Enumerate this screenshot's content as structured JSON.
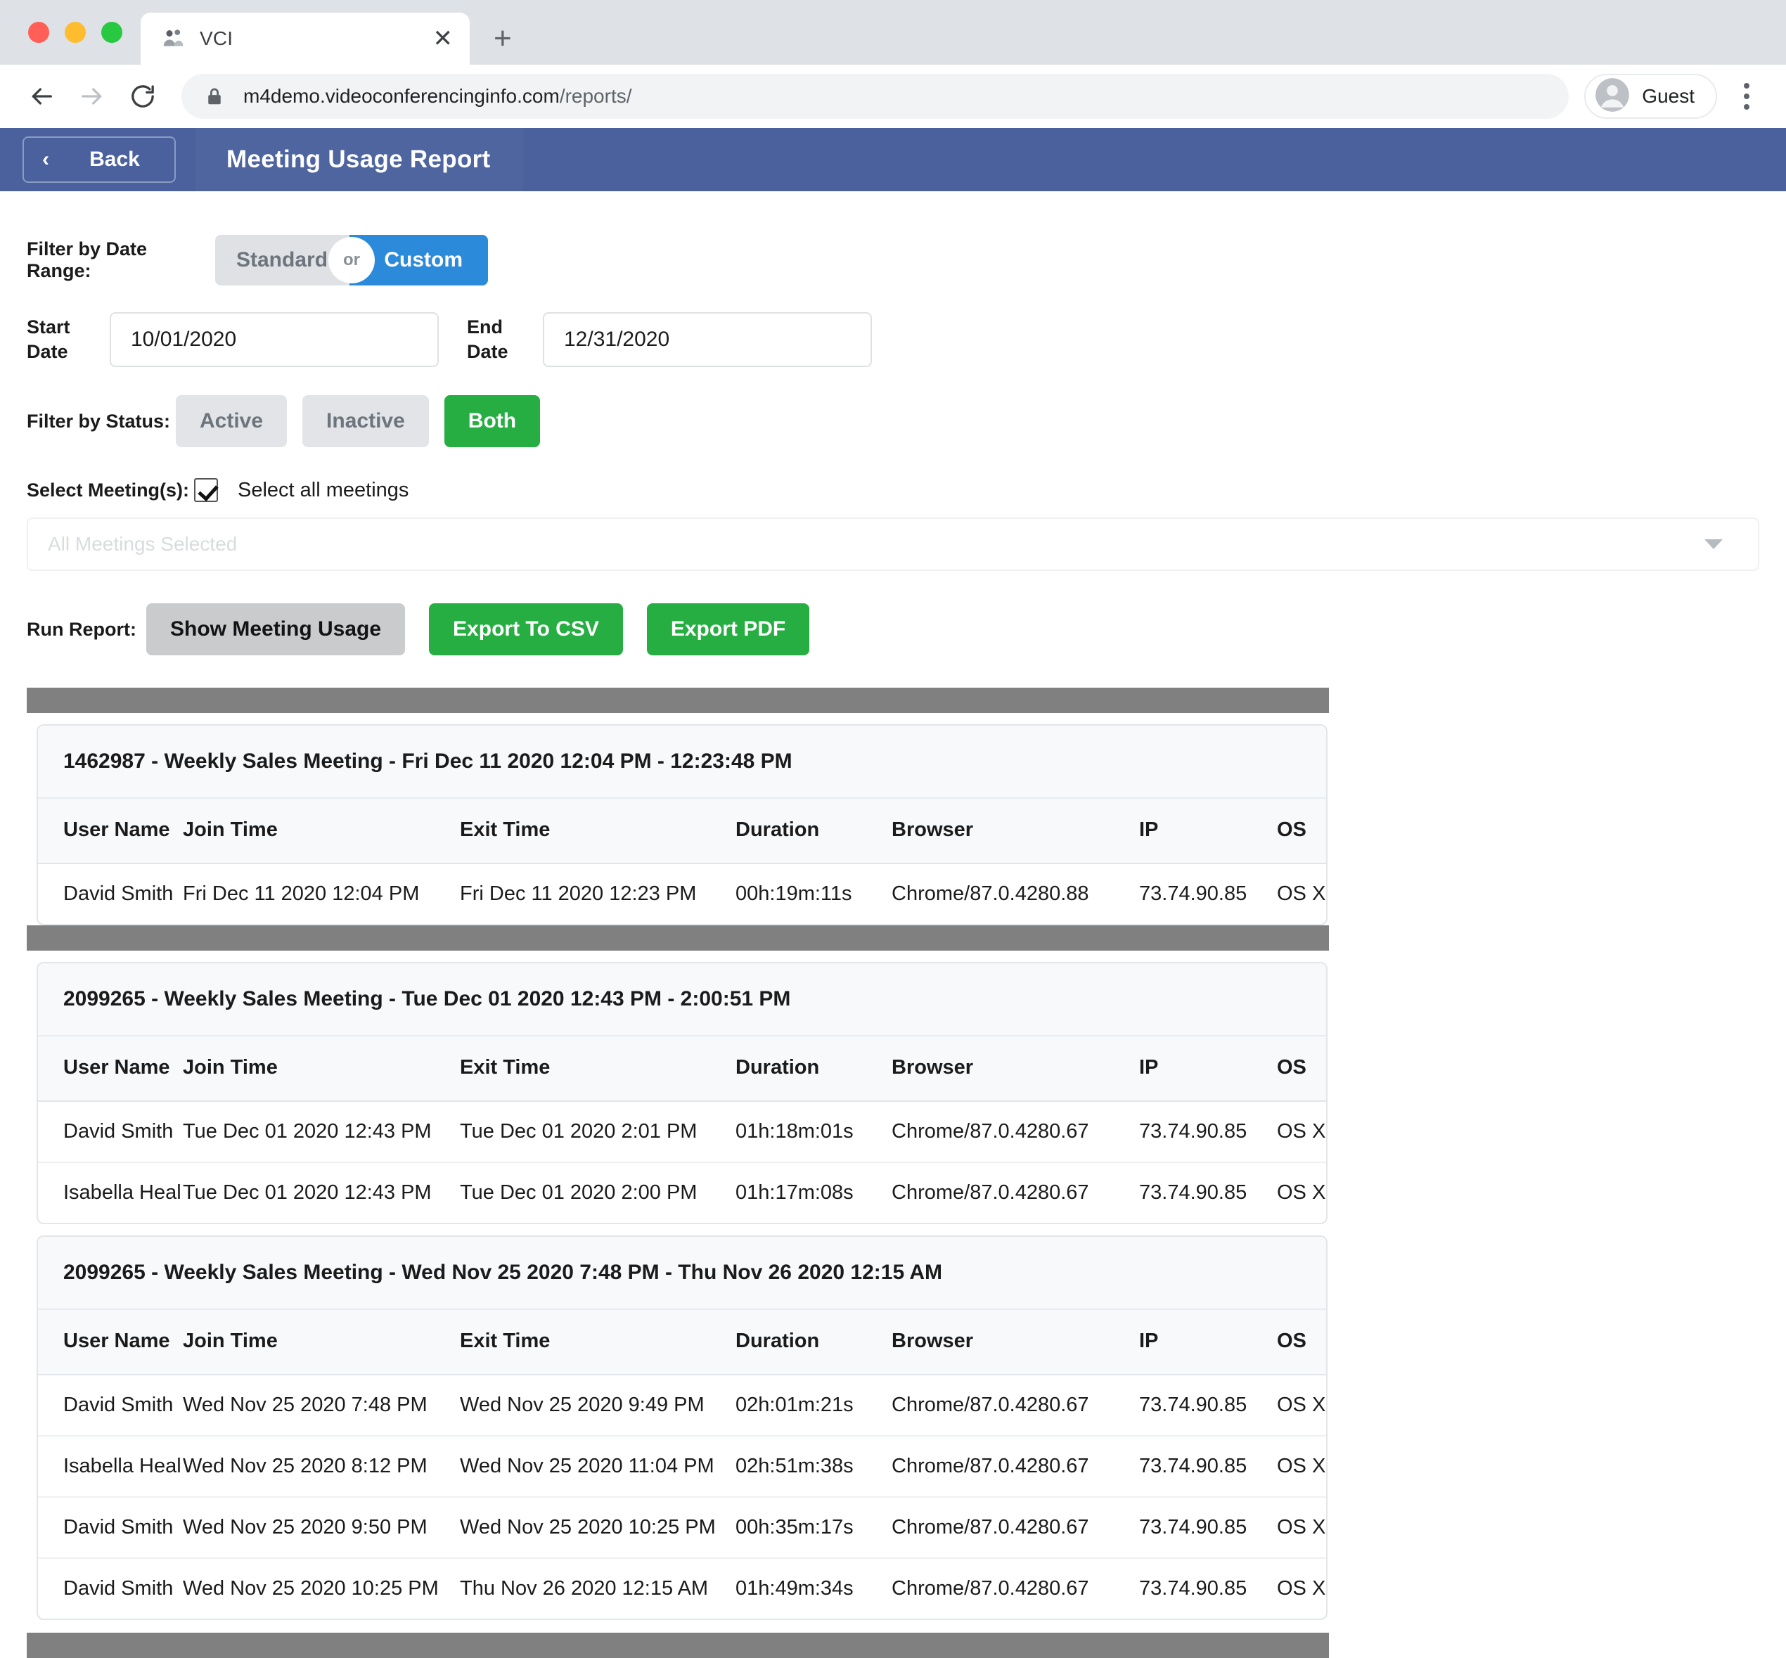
{
  "browser": {
    "tab_title": "VCI",
    "tab_favicon_icon": "people-group-icon",
    "tab_close_icon": "close-icon",
    "new_tab_icon": "plus-icon",
    "back_nav_icon": "arrow-left-icon",
    "forward_nav_icon": "arrow-right-icon",
    "reload_icon": "reload-icon",
    "lock_icon": "lock-icon",
    "url_host": "m4demo.videoconferencinginfo.com",
    "url_path": "/reports/",
    "profile_name": "Guest",
    "profile_icon": "account-circle-icon",
    "menu_icon": "kebab-menu-icon"
  },
  "app_header": {
    "back_chevron": "‹",
    "back_label": "Back",
    "title": "Meeting Usage Report"
  },
  "filters": {
    "date_range_label": "Filter by Date Range:",
    "date_range_standard": "Standard",
    "date_range_or": "or",
    "date_range_custom": "Custom",
    "start_date_label": "Start Date",
    "start_date_value": "10/01/2020",
    "end_date_label": "End Date",
    "end_date_value": "12/31/2020",
    "status_label": "Filter by Status:",
    "status_active": "Active",
    "status_inactive": "Inactive",
    "status_both": "Both",
    "select_meetings_label": "Select Meeting(s):",
    "select_all_label": "Select all meetings",
    "select_all_checked": true,
    "meetings_placeholder": "All Meetings Selected",
    "dropdown_caret_icon": "chevron-down-icon"
  },
  "actions": {
    "run_report_label": "Run Report:",
    "show_usage": "Show Meeting Usage",
    "export_csv": "Export To CSV",
    "export_pdf": "Export PDF"
  },
  "table_headers": [
    "User Name",
    "Join Time",
    "Exit Time",
    "Duration",
    "Browser",
    "IP",
    "OS"
  ],
  "report_sections": [
    {
      "title": "1462987 - Weekly Sales Meeting - Fri Dec 11 2020 12:04 PM - 12:23:48 PM",
      "rows": [
        {
          "user": "David Smith",
          "join": "Fri Dec 11 2020 12:04 PM",
          "exit": "Fri Dec 11 2020 12:23 PM",
          "duration": "00h:19m:11s",
          "browser": "Chrome/87.0.4280.88",
          "ip": "73.74.90.85",
          "os": "OS X"
        }
      ]
    },
    {
      "title": "2099265 - Weekly Sales Meeting - Tue Dec 01 2020 12:43 PM - 2:00:51 PM",
      "rows": [
        {
          "user": "David Smith",
          "join": "Tue Dec 01 2020 12:43 PM",
          "exit": "Tue Dec 01 2020 2:01 PM",
          "duration": "01h:18m:01s",
          "browser": "Chrome/87.0.4280.67",
          "ip": "73.74.90.85",
          "os": "OS X"
        },
        {
          "user": "Isabella Heal",
          "join": "Tue Dec 01 2020 12:43 PM",
          "exit": "Tue Dec 01 2020 2:00 PM",
          "duration": "01h:17m:08s",
          "browser": "Chrome/87.0.4280.67",
          "ip": "73.74.90.85",
          "os": "OS X"
        }
      ]
    },
    {
      "title": "2099265 - Weekly Sales Meeting - Wed Nov 25 2020 7:48 PM - Thu Nov 26 2020 12:15 AM",
      "rows": [
        {
          "user": "David Smith",
          "join": "Wed Nov 25 2020 7:48 PM",
          "exit": "Wed Nov 25 2020 9:49 PM",
          "duration": "02h:01m:21s",
          "browser": "Chrome/87.0.4280.67",
          "ip": "73.74.90.85",
          "os": "OS X"
        },
        {
          "user": "Isabella Heal",
          "join": "Wed Nov 25 2020 8:12 PM",
          "exit": "Wed Nov 25 2020 11:04 PM",
          "duration": "02h:51m:38s",
          "browser": "Chrome/87.0.4280.67",
          "ip": "73.74.90.85",
          "os": "OS X"
        },
        {
          "user": "David Smith",
          "join": "Wed Nov 25 2020 9:50 PM",
          "exit": "Wed Nov 25 2020 10:25 PM",
          "duration": "00h:35m:17s",
          "browser": "Chrome/87.0.4280.67",
          "ip": "73.74.90.85",
          "os": "OS X"
        },
        {
          "user": "David Smith",
          "join": "Wed Nov 25 2020 10:25 PM",
          "exit": "Thu Nov 26 2020 12:15 AM",
          "duration": "01h:49m:34s",
          "browser": "Chrome/87.0.4280.67",
          "ip": "73.74.90.85",
          "os": "OS X"
        }
      ]
    }
  ],
  "colors": {
    "app_header_blue": "#4a619e",
    "accent_blue": "#2b8ad9",
    "accent_green": "#27ae42",
    "divider_grey": "#808080"
  }
}
